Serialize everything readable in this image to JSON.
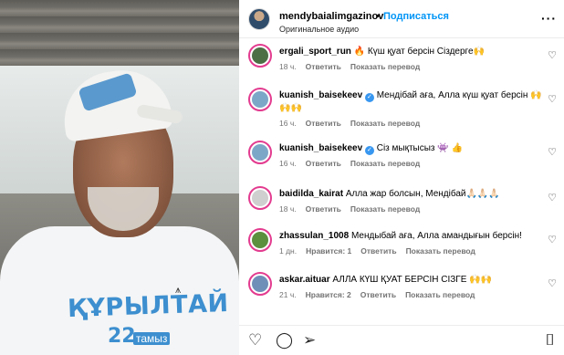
{
  "header": {
    "username": "mendybaialimgazinov",
    "separator": "•",
    "follow_label": "Подписаться",
    "audio_label": "Оригинальное аудио",
    "more_icon": "more-horizontal-icon"
  },
  "photo": {
    "shirt_text": "ҚҰРЫЛТАЙ",
    "shirt_sub": "22",
    "shirt_sub2": "тамыз"
  },
  "comments": [
    {
      "username": "ergali_sport_run",
      "verified": false,
      "text": "🔥 Күш қуат берсін Сіздерге🙌",
      "time": "18 ч.",
      "likes": "",
      "reply": "Ответить",
      "translate": "Показать перевод",
      "avatar_color": "#4d6f46"
    },
    {
      "username": "kuanish_baisekeev",
      "verified": true,
      "text": "Мендібай аға, Алла күш қуат берсін 🙌🙌🙌",
      "time": "16 ч.",
      "likes": "",
      "reply": "Ответить",
      "translate": "Показать перевод",
      "avatar_color": "#7da7c7"
    },
    {
      "username": "kuanish_baisekeev",
      "verified": true,
      "text": "Сіз мықтысыз 👾 👍",
      "time": "16 ч.",
      "likes": "",
      "reply": "Ответить",
      "translate": "Показать перевод",
      "avatar_color": "#7da7c7"
    },
    {
      "username": "baidilda_kairat",
      "verified": false,
      "text": "Алла жар болсын, Мендібай🙏🏻🙏🏻🙏🏻",
      "time": "18 ч.",
      "likes": "",
      "reply": "Ответить",
      "translate": "Показать перевод",
      "avatar_color": "#cfcfcf"
    },
    {
      "username": "zhassulan_1008",
      "verified": false,
      "text": "Мендыбай аға, Алла амандығын берсін!",
      "time": "1 дн.",
      "likes": "Нравится: 1",
      "reply": "Ответить",
      "translate": "Показать перевод",
      "avatar_color": "#5c8f3e"
    },
    {
      "username": "askar.aituar",
      "verified": false,
      "text": "АЛЛА КҮШ ҚУАТ БЕРСІН СІЗГЕ 🙌🙌",
      "time": "21 ч.",
      "likes": "Нравится: 2",
      "reply": "Ответить",
      "translate": "Показать перевод",
      "avatar_color": "#6f8fb8"
    }
  ],
  "actions": {
    "like_icon": "heart-icon",
    "comment_icon": "comment-icon",
    "share_icon": "share-icon",
    "save_icon": "bookmark-icon"
  }
}
